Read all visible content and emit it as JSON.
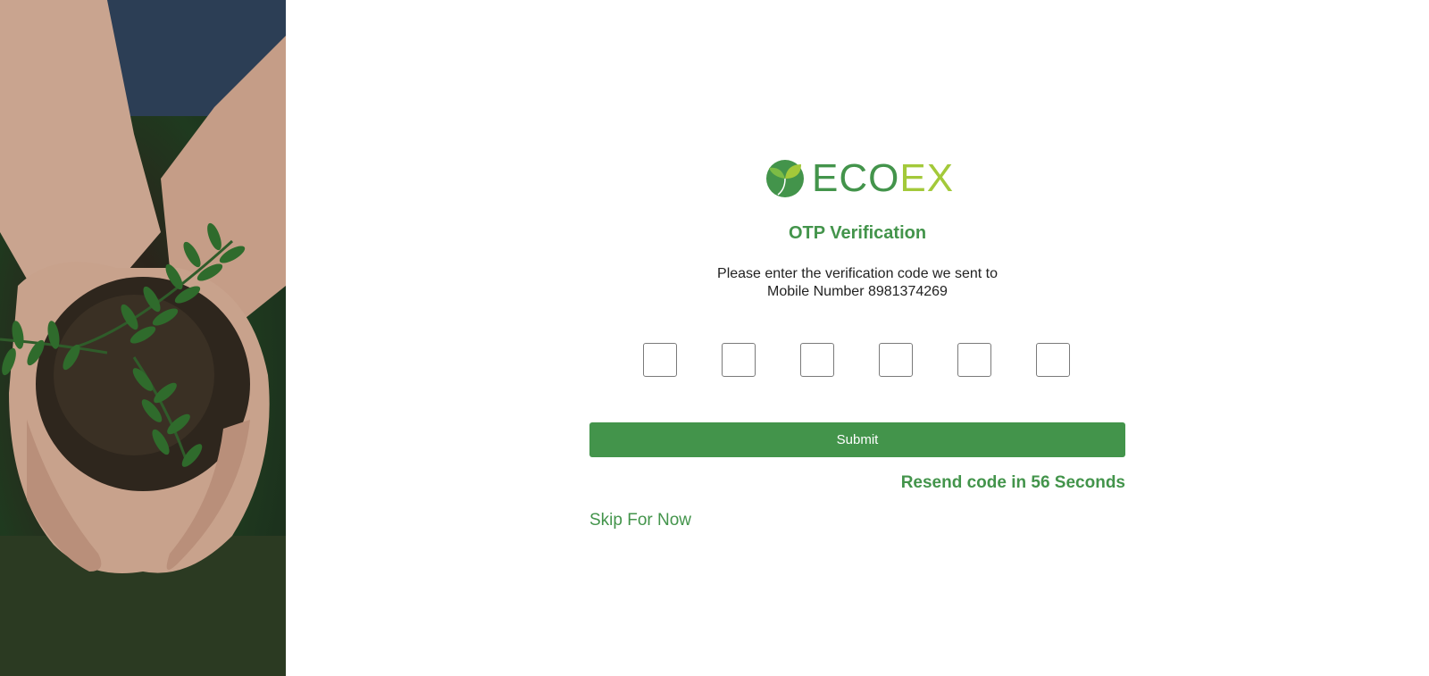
{
  "brand": {
    "name_part1": "ECO",
    "name_part2": "EX",
    "primary_color": "#43944b",
    "accent_color": "#a3c93a"
  },
  "side_image": {
    "icon": "hands-holding-plant-photo"
  },
  "otp": {
    "title": "OTP Verification",
    "instruction_line1": "Please enter the verification code we sent to",
    "instruction_line2": "Mobile Number 8981374269",
    "digit_count": 6,
    "digits": [
      "",
      "",
      "",
      "",
      "",
      ""
    ]
  },
  "actions": {
    "submit_label": "Submit",
    "resend_text": "Resend code in 56 Seconds",
    "skip_label": "Skip For Now"
  }
}
